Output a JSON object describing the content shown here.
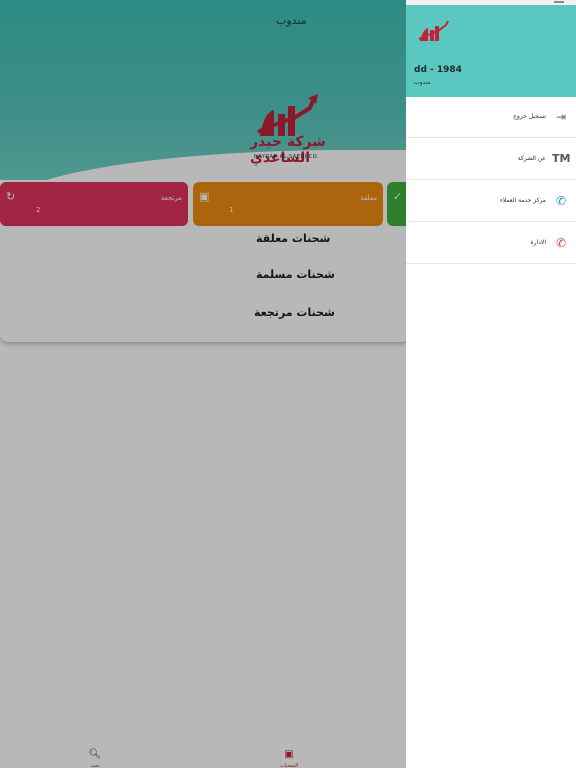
{
  "app": {
    "title": "مندوب"
  },
  "branding": {
    "company_ar": "شركة حيدر الساعدي",
    "company_en": "HAYDAR AL-SAEDI CO."
  },
  "cards": [
    {
      "label": "مرتجعة",
      "count": "2",
      "color": "#e2325d",
      "icon": "refresh-icon"
    },
    {
      "label": "معلقة",
      "count": "1",
      "color": "#ef8d13",
      "icon": "document-icon"
    },
    {
      "label": "",
      "count": "",
      "color": "#43b03e",
      "icon": "check-icon"
    }
  ],
  "shipment_list": [
    "شحنات معلقة",
    "شحنات مسلمة",
    "شحنات مرتجعة"
  ],
  "bottom_nav": {
    "search_label": "بحث",
    "orders_label": "الشحنات"
  },
  "drawer": {
    "user": "dd - 1984",
    "role": "مندوب",
    "menu": [
      {
        "label": "تسجيل خروج",
        "icon": "logout-icon",
        "color": "#6b6b6b"
      },
      {
        "label": "عن الشركة",
        "icon": "tm-icon",
        "color": "#555555"
      },
      {
        "label": "مركز خدمة العملاء",
        "icon": "phone-icon",
        "color": "#2a88d8"
      },
      {
        "label": "الادارة",
        "icon": "phone-icon",
        "color": "#e53935"
      }
    ]
  },
  "colors": {
    "header": "#56c6bd",
    "brand_red": "#c2233a",
    "drawer_head": "#5bc7c1"
  }
}
